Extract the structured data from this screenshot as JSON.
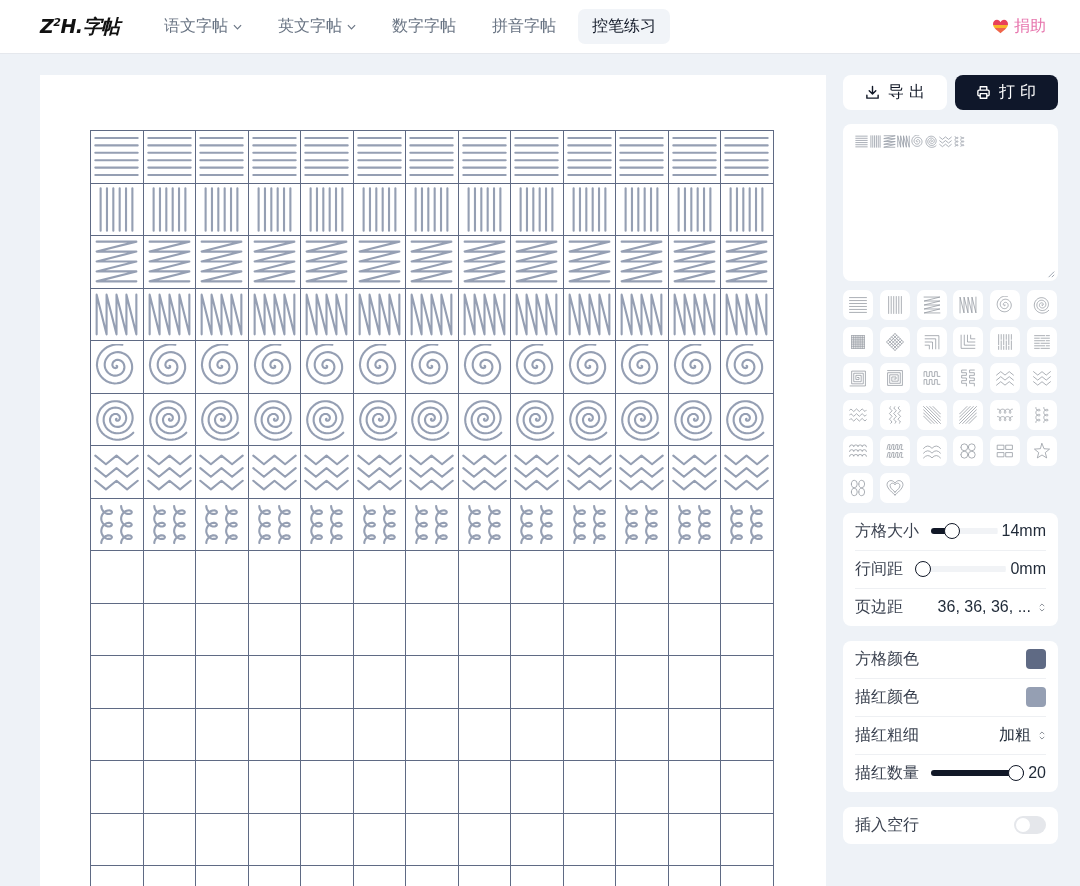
{
  "header": {
    "logo": "Z$^{2}$H.字帖",
    "nav": [
      {
        "label": "语文字帖",
        "dropdown": true,
        "selected": false
      },
      {
        "label": "英文字帖",
        "dropdown": true,
        "selected": false
      },
      {
        "label": "数字字帖",
        "dropdown": false,
        "selected": false
      },
      {
        "label": "拼音字帖",
        "dropdown": false,
        "selected": false
      },
      {
        "label": "控笔练习",
        "dropdown": false,
        "selected": true
      }
    ],
    "donate": "捐助"
  },
  "worksheet": {
    "rows": [
      {
        "kind": "horizontal-lines"
      },
      {
        "kind": "vertical-lines"
      },
      {
        "kind": "horizontal-zigzag"
      },
      {
        "kind": "vertical-zigzag"
      },
      {
        "kind": "spiral"
      },
      {
        "kind": "spiral-tight"
      },
      {
        "kind": "valley-zigzag"
      },
      {
        "kind": "vertical-loops"
      },
      {
        "kind": "blank"
      },
      {
        "kind": "blank"
      },
      {
        "kind": "blank"
      },
      {
        "kind": "blank"
      },
      {
        "kind": "blank"
      },
      {
        "kind": "blank"
      },
      {
        "kind": "blank"
      }
    ]
  },
  "actions": [
    {
      "kind": "export",
      "label": "导出"
    },
    {
      "kind": "print",
      "label": "打印"
    }
  ],
  "pattern_field": {
    "items": [
      {
        "kind": "horizontal-lines"
      },
      {
        "kind": "vertical-lines"
      },
      {
        "kind": "horizontal-zigzag"
      },
      {
        "kind": "vertical-zigzag"
      },
      {
        "kind": "spiral"
      },
      {
        "kind": "spiral-tight"
      },
      {
        "kind": "valley-zigzag"
      },
      {
        "kind": "vertical-loops"
      }
    ]
  },
  "pattern_palette": [
    {
      "kind": "horizontal-lines"
    },
    {
      "kind": "vertical-lines"
    },
    {
      "kind": "horizontal-zigzag"
    },
    {
      "kind": "vertical-zigzag"
    },
    {
      "kind": "spiral"
    },
    {
      "kind": "spiral-tight"
    },
    {
      "kind": "grid"
    },
    {
      "kind": "diamond-grid"
    },
    {
      "kind": "corner-lines"
    },
    {
      "kind": "corner-lines-reversed"
    },
    {
      "kind": "vertical-dashes"
    },
    {
      "kind": "horizontal-dashes"
    },
    {
      "kind": "square-spiral"
    },
    {
      "kind": "square-spiral-double"
    },
    {
      "kind": "square-wave"
    },
    {
      "kind": "vertical-square-wave"
    },
    {
      "kind": "peak-zigzag"
    },
    {
      "kind": "valley-zigzag"
    },
    {
      "kind": "horizontal-waves"
    },
    {
      "kind": "vertical-waves"
    },
    {
      "kind": "backslash-lines"
    },
    {
      "kind": "slash-lines"
    },
    {
      "kind": "horizontal-loops"
    },
    {
      "kind": "vertical-loops"
    },
    {
      "kind": "arches"
    },
    {
      "kind": "slanted-square-wave"
    },
    {
      "kind": "scallops"
    },
    {
      "kind": "four-circles"
    },
    {
      "kind": "four-rectangles"
    },
    {
      "kind": "star"
    },
    {
      "kind": "figure-eights"
    },
    {
      "kind": "nested-heart"
    }
  ],
  "settings_groups": [
    [
      {
        "kind": "slider",
        "label": "方格大小",
        "level": 0.25,
        "value": "14mm"
      },
      {
        "kind": "slider",
        "label": "行间距",
        "level": 0,
        "value": "0mm"
      },
      {
        "kind": "select",
        "label": "页边距",
        "value": "36, 36, 36, ..."
      }
    ],
    [
      {
        "kind": "color",
        "label": "方格颜色",
        "color": "#5f6a84"
      },
      {
        "kind": "color",
        "label": "描红颜色",
        "color": "#959fb3"
      },
      {
        "kind": "select",
        "label": "描红粗细",
        "value": "加粗"
      },
      {
        "kind": "slider",
        "label": "描红数量",
        "level": 1,
        "value": "20"
      }
    ],
    [
      {
        "kind": "toggle",
        "label": "插入空行",
        "on": false
      }
    ]
  ]
}
